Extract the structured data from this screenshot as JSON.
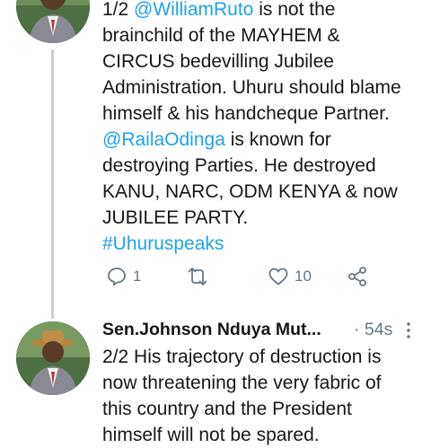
{
  "tweet1": {
    "lines": [
      [
        {
          "text": "1/2 ",
          "link": false
        },
        {
          "text": "@WilliamRuto",
          "link": true
        },
        {
          "text": " is not the",
          "link": false
        }
      ],
      [
        {
          "text": "brainchild of the MAYHEM &",
          "link": false
        }
      ],
      [
        {
          "text": "CIRCUS bedevilling Jubilee",
          "link": false
        }
      ],
      [
        {
          "text": "Administration. Uhuru should blame",
          "link": false
        }
      ],
      [
        {
          "text": "himself & his handcheque Partner.",
          "link": false
        }
      ],
      [
        {
          "text": "@RailaOdinga",
          "link": true
        },
        {
          "text": " is known for",
          "link": false
        }
      ],
      [
        {
          "text": "destroying Parties. He destroyed",
          "link": false
        }
      ],
      [
        {
          "text": "KANU, NARC, ODM KENYA & now",
          "link": false
        }
      ],
      [
        {
          "text": "JUBILEE PARTY.",
          "link": false
        }
      ],
      [
        {
          "text": "#Uhuruspeaks",
          "link": true
        }
      ]
    ],
    "reply_count": "1",
    "like_count": "10"
  },
  "tweet2": {
    "author_name": "Sen.Johnson Nduya Mut...",
    "timestamp": "· 54s",
    "lines": [
      "2/2 His trajectory of destruction is",
      "now threatening the very fabric of",
      "this country and the President",
      "himself will not be spared."
    ]
  },
  "colors": {
    "link": "#1da1f2",
    "muted": "#657786",
    "text": "#14171a",
    "thread": "#c4cfd6"
  },
  "icons": [
    "reply-icon",
    "retweet-icon",
    "like-icon",
    "share-icon",
    "more-options-icon"
  ]
}
